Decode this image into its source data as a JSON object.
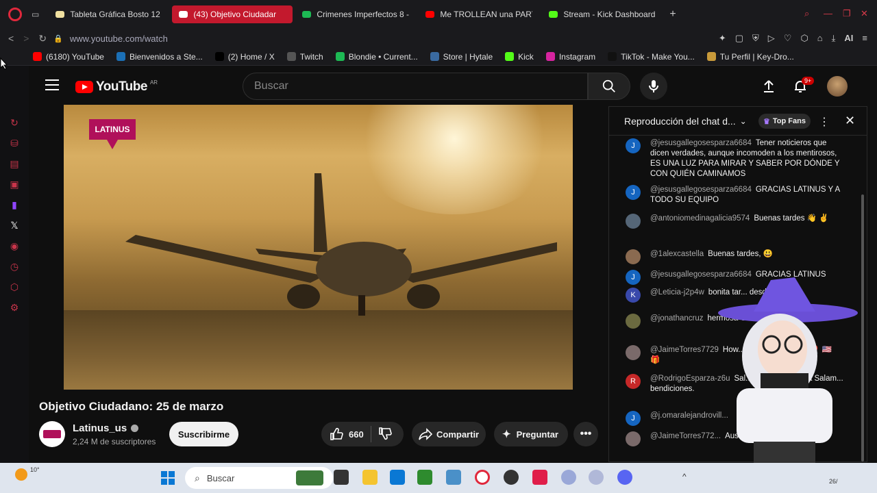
{
  "browser": {
    "tabs": [
      {
        "label": "Tableta Gráfica Bosto 12",
        "color": "#f0e0a0",
        "active": false
      },
      {
        "label": "(43) Objetivo Ciudadar",
        "color": "#ffffff",
        "active": true
      },
      {
        "label": "Crimenes Imperfectos 8 -",
        "color": "#1db954",
        "active": false
      },
      {
        "label": "Me TROLLEAN una PARTI",
        "color": "#ff0000",
        "active": false
      },
      {
        "label": "Stream - Kick Dashboard",
        "color": "#53fc18",
        "active": false
      }
    ],
    "new_tab": "+",
    "url": "www.youtube.com/watch",
    "ai_label": "AI",
    "bookmarks": [
      {
        "label": "(6180) YouTube",
        "color": "#ff0000"
      },
      {
        "label": "Bienvenidos a Ste...",
        "color": "#1b6fb5"
      },
      {
        "label": "(2) Home / X",
        "color": "#000000"
      },
      {
        "label": "Twitch",
        "color": "#555555"
      },
      {
        "label": "Blondie • Current...",
        "color": "#1db954"
      },
      {
        "label": "Store | Hytale",
        "color": "#3a6aa0"
      },
      {
        "label": "Kick",
        "color": "#53fc18"
      },
      {
        "label": "Instagram",
        "color": "#d6249f"
      },
      {
        "label": "TikTok - Make You...",
        "color": "#111111"
      },
      {
        "label": "Tu Perfil | Key-Dro...",
        "color": "#c89a3a"
      }
    ]
  },
  "youtube": {
    "logo_text": "YouTube",
    "country": "AR",
    "search_placeholder": "Buscar",
    "notif_badge": "9+",
    "video": {
      "brand": "LATINUS",
      "title": "Objetivo Ciudadano: 25 de marzo",
      "channel": "Latinus_us",
      "subscribers": "2,24 M de suscriptores",
      "subscribe": "Suscribirme",
      "likes": "660",
      "share": "Compartir",
      "ask": "Preguntar"
    }
  },
  "chat": {
    "title": "Reproducción del chat d...",
    "mode": "Top Fans",
    "messages": [
      {
        "initial": "J",
        "avatar_color": "#1565c0",
        "user": "@jesusgallegosesparza6684",
        "text": "Tener noticieros que dicen verdades, aunque incomoden a los mentirosos, ES UNA LUZ PARA MIRAR Y SABER POR DÓNDE Y CON QUIÉN CAMINAMOS"
      },
      {
        "initial": "J",
        "avatar_color": "#1565c0",
        "user": "@jesusgallegosesparza6684",
        "text": "GRACIAS LATINUS Y A TODO SU EQUIPO"
      },
      {
        "initial": "",
        "avatar_color": "#556677",
        "user": "@antoniomedinagalicia9574",
        "text": "Buenas tardes 👋 ✌"
      },
      {
        "initial": "",
        "avatar_color": "#8a6a50",
        "user": "@1alexcastella",
        "text": "Buenas tardes, 😃"
      },
      {
        "initial": "J",
        "avatar_color": "#1565c0",
        "user": "@jesusgallegosesparza6684",
        "text": "GRACIAS LATINUS"
      },
      {
        "initial": "K",
        "avatar_color": "#3949ab",
        "user": "@Leticia-j2p4w",
        "text": "bonita tar... desde Toluca"
      },
      {
        "initial": "",
        "avatar_color": "#6b6a40",
        "user": "@jonathancruz",
        "text": "hermosa Cecili..."
      },
      {
        "initial": "",
        "avatar_color": "#7a6a6a",
        "user": "@JaimeTorres7729",
        "text": "How... ...manca... ⌚ 👋 🎈 🇺🇸 🎁"
      },
      {
        "initial": "R",
        "avatar_color": "#c62828",
        "user": "@RodrigoEsparza-z6u",
        "text": "Sal... princesa, Cecilia Salam... bendiciones."
      },
      {
        "initial": "J",
        "avatar_color": "#1565c0",
        "user": "@j.omaralejandrovill...",
        "text": ""
      },
      {
        "initial": "",
        "avatar_color": "#7a6a6a",
        "user": "@JaimeTorres772...",
        "text": "Austeros......."
      }
    ]
  },
  "taskbar": {
    "weather": "10°",
    "search": "Buscar",
    "time": "26/"
  }
}
